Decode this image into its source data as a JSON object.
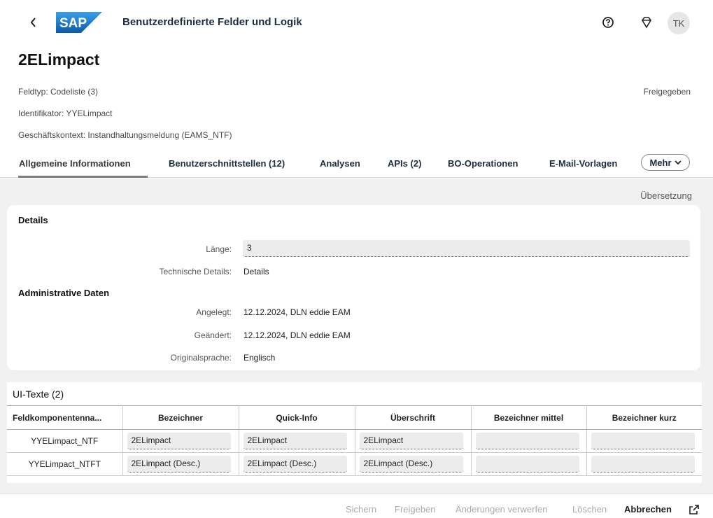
{
  "shell": {
    "back": "‹",
    "logo_text": "SAP",
    "title": "Benutzerdefinierte Felder und Logik",
    "avatar": "TK"
  },
  "header": {
    "title": "2ELimpact",
    "feldtyp": "Feldtyp: Codeliste (3)",
    "identifikator": "Identifikator: YYELimpact",
    "kontext": "Geschäftskontext: Instandhaltungsmeldung (EAMS_NTF)",
    "status": "Freigegeben"
  },
  "tabs": {
    "t1": "Allgemeine Informationen",
    "t2": "Benutzerschnittstellen (12)",
    "t3": "Analysen",
    "t4": "APIs (2)",
    "t5": "BO-Operationen",
    "t6": "E-Mail-Vorlagen",
    "more": "Mehr"
  },
  "content": {
    "translation_link": "Übersetzung",
    "details_title": "Details",
    "length_label": "Länge:",
    "length_value": "3",
    "tech_label": "Technische Details:",
    "tech_value": "Details",
    "admin_title": "Administrative Daten",
    "created_label": "Angelegt:",
    "created_value": "12.12.2024, DLN eddie EAM",
    "changed_label": "Geändert:",
    "changed_value": "12.12.2024, DLN eddie EAM",
    "lang_label": "Originalsprache:",
    "lang_value": "Englisch"
  },
  "ui_texts": {
    "title": "UI-Texte (2)",
    "columns": [
      "Feldkomponentenna...",
      "Bezeichner",
      "Quick-Info",
      "Überschrift",
      "Bezeichner mittel",
      "Bezeichner kurz"
    ],
    "rows": [
      [
        "YYELimpact_NTF",
        "2ELimpact",
        "2ELimpact",
        "2ELimpact",
        "",
        ""
      ],
      [
        "YYELimpact_NTFT",
        "2ELimpact (Desc.)",
        "2ELimpact (Desc.)",
        "2ELimpact (Desc.)",
        "",
        ""
      ]
    ]
  },
  "footer": {
    "save": "Sichern",
    "release": "Freigeben",
    "discard": "Änderungen verwerfen",
    "delete": "Löschen",
    "cancel": "Abbrechen"
  },
  "colors": {
    "sap_blue": "#1a7bc9",
    "background": "#f1f1f1",
    "field_bg": "#ececec"
  }
}
